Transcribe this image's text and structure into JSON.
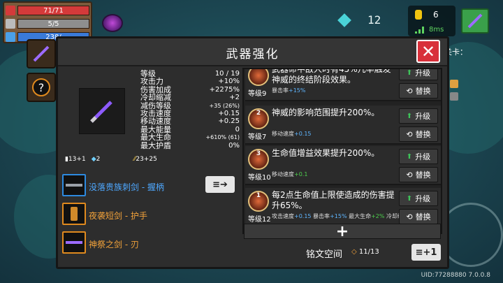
{
  "hud": {
    "hp": "71/71",
    "shield": "5/5",
    "energy": "238/",
    "gems": "12",
    "coins": "6",
    "ping": "8ms",
    "level_text": "关卡：",
    "uid": "UID:77288880 7.0.0.8",
    "colors": {
      "hp": "#d43a3a",
      "shield": "#9a9a9a",
      "energy": "#3a7ad8"
    }
  },
  "modal": {
    "title": "武器强化",
    "close": "✕",
    "stats": [
      {
        "label": "等级",
        "value": "10 / 19"
      },
      {
        "label": "攻击力",
        "value": "+10%"
      },
      {
        "label": "伤害加成",
        "value": "+2275%"
      },
      {
        "label": "冷却缩减",
        "value": "+2"
      },
      {
        "label": "减伤等级",
        "value": "+35 (26%)",
        "small": true
      },
      {
        "label": "攻击速度",
        "value": "+0.15"
      },
      {
        "label": "移动速度",
        "value": "+0.25"
      },
      {
        "label": "最大能量",
        "value": "0"
      },
      {
        "label": "最大生命",
        "value": "+610% (61)",
        "small": true
      },
      {
        "label": "最大护盾",
        "value": "0%"
      }
    ],
    "mini_stats": [
      "13+1",
      "2",
      "23+25"
    ],
    "components": [
      {
        "label": "没落贵族刺剑 - 握柄",
        "color": "blue"
      },
      {
        "label": "夜袭短剑 - 护手",
        "color": "orange"
      },
      {
        "label": "神祭之剑 - 刃",
        "color": "orange"
      }
    ],
    "inscriptions": [
      {
        "badge": "",
        "level": "等级9",
        "text": "武器命中敌人时有45%几率触发神威的终结阶段效果。",
        "sub": [
          {
            "t": "暴击率",
            "c": ""
          },
          {
            "t": "+15%",
            "c": "b"
          }
        ]
      },
      {
        "badge": "2",
        "level": "等级7",
        "text": "神威的影响范围提升200%。",
        "sub": [
          {
            "t": "移动速度",
            "c": ""
          },
          {
            "t": "+0.15",
            "c": "b"
          }
        ]
      },
      {
        "badge": "3",
        "level": "等级10",
        "text": "生命值增益效果提升200%。",
        "sub": [
          {
            "t": "移动速度",
            "c": ""
          },
          {
            "t": "+0.1",
            "c": "g"
          }
        ]
      },
      {
        "badge": "1",
        "level": "等级12",
        "text": "每2点生命值上限使造成的伤害提升65%。",
        "sub": [
          {
            "t": "攻击速度",
            "c": ""
          },
          {
            "t": "+0.15",
            "c": "b"
          },
          {
            "t": " 暴击率",
            "c": ""
          },
          {
            "t": "+15%",
            "c": "b"
          },
          {
            "t": " 最大生命",
            "c": ""
          },
          {
            "t": "+2%",
            "c": "g"
          },
          {
            "t": " 冷却缩减",
            "c": ""
          },
          {
            "t": "+2",
            "c": "g"
          }
        ]
      }
    ],
    "upgrade_label": "升级",
    "replace_label": "替换",
    "add_label": "+",
    "inscription_space_label": "铭文空间",
    "inscription_space_value": "11/13",
    "swap_all_label": "≡➔",
    "expand_label": "≡+1"
  }
}
